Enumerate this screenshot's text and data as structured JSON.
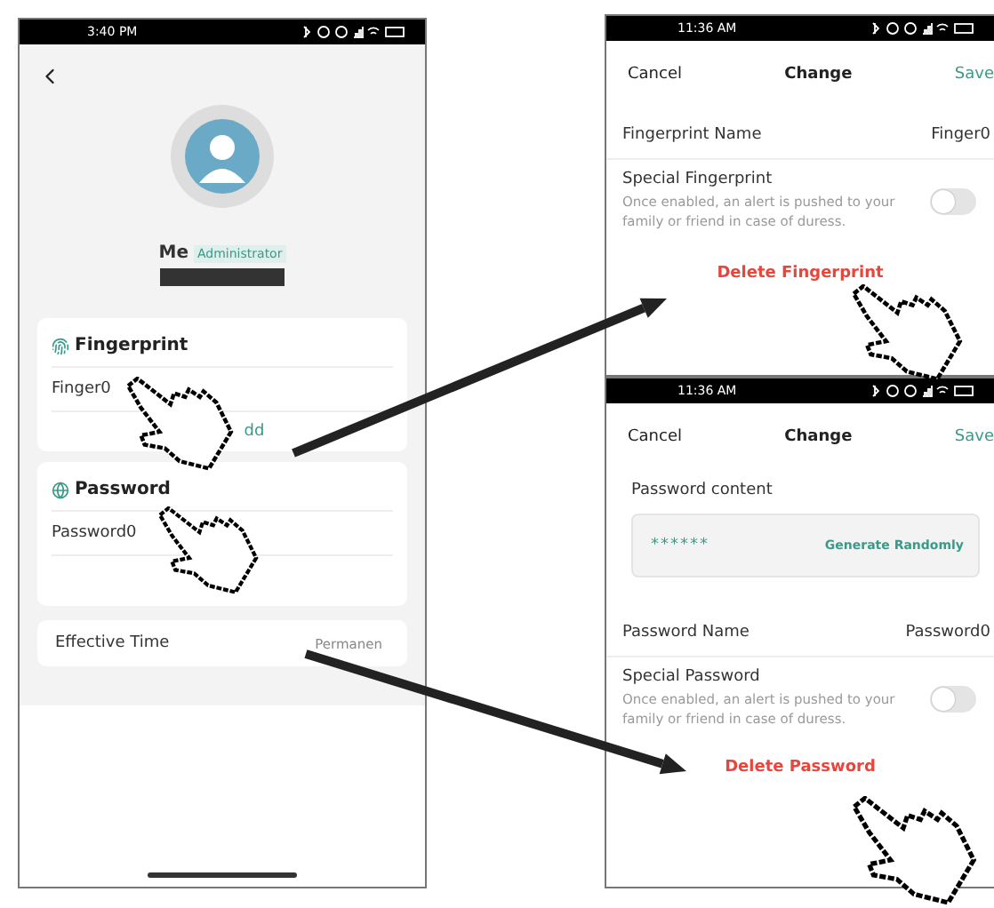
{
  "main_screen": {
    "status_bar": {
      "time": "3:40 PM"
    },
    "profile": {
      "name": "Me",
      "role": "Administrator"
    },
    "sections": [
      {
        "kind": "fingerprint",
        "title": "Fingerprint",
        "items": [
          "Finger0"
        ],
        "action": "dd"
      },
      {
        "kind": "password",
        "title": "Password",
        "items": [
          "Password0"
        ]
      }
    ],
    "effective_time": {
      "label": "Effective Time",
      "value": "Permanen"
    }
  },
  "fingerprint_edit": {
    "status_bar": {
      "time": "11:36 AM"
    },
    "cancel": "Cancel",
    "title": "Change",
    "save": "Save",
    "name_row": {
      "label": "Fingerprint Name",
      "value": "Finger0"
    },
    "special": {
      "title": "Special Fingerprint",
      "description": "Once enabled, an alert is pushed to your family or friend in case of duress.",
      "on": false
    },
    "delete": "Delete Fingerprint"
  },
  "password_edit": {
    "status_bar": {
      "time": "11:36 AM"
    },
    "cancel": "Cancel",
    "title": "Change",
    "save": "Save",
    "content": {
      "label": "Password content",
      "value": "******",
      "generate": "Generate Randomly"
    },
    "name_row": {
      "label": "Password Name",
      "value": "Password0"
    },
    "special": {
      "title": "Special Password",
      "description": "Once enabled, an alert is pushed to your family or friend in case of duress.",
      "on": false
    },
    "delete": "Delete Password"
  }
}
